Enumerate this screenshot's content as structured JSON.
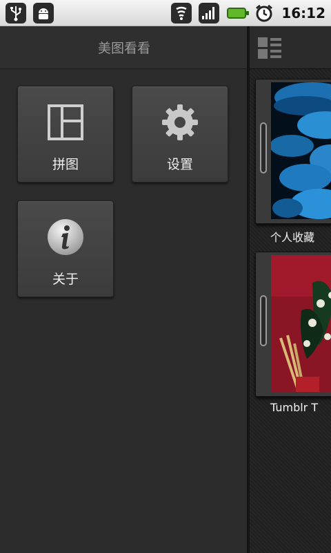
{
  "status_bar": {
    "left_icons": [
      "usb-icon",
      "android-debug-icon"
    ],
    "right_icons": [
      "wifi-icon",
      "signal-icon",
      "battery-icon",
      "alarm-icon"
    ],
    "time": "16:12",
    "colors": {
      "battery": "#63b82a"
    }
  },
  "left_panel": {
    "title": "美图看看",
    "tiles": [
      {
        "label": "拼图",
        "icon": "collage-icon"
      },
      {
        "label": "设置",
        "icon": "gear-icon"
      },
      {
        "label": "关于",
        "icon": "info-icon"
      }
    ]
  },
  "right_panel": {
    "header_icon": "list-view-icon",
    "albums": [
      {
        "title": "个人收藏",
        "thumbnail": "jellyfish-photo"
      },
      {
        "title": "Tumblr T",
        "thumbnail": "flowers-photo"
      }
    ]
  }
}
